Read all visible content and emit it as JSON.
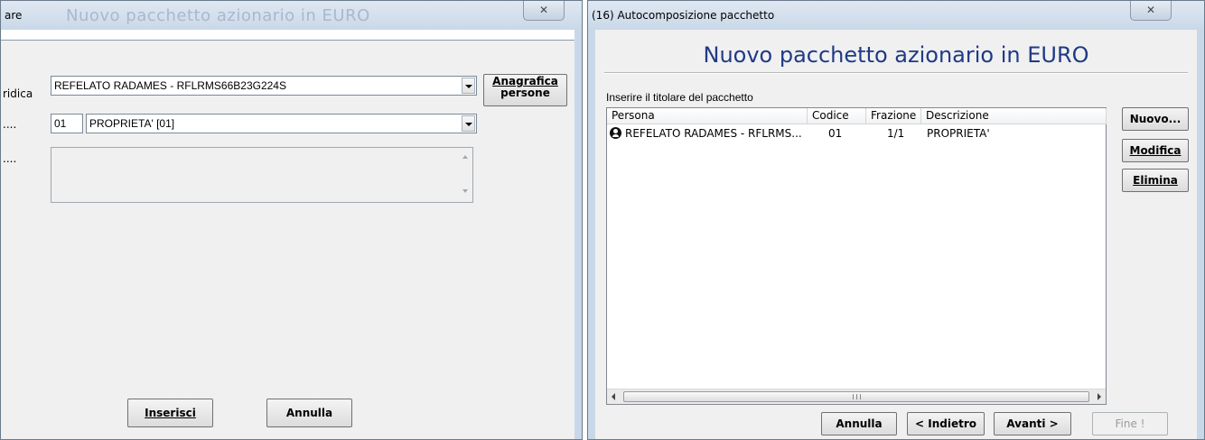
{
  "left_dialog": {
    "title_fragment": "are",
    "ghost_title": "Nuovo pacchetto azionario in EURO",
    "close_glyph": "✕",
    "label_persona": "ridica",
    "label_tipo": "....",
    "label_note": "....",
    "persona_value": "REFELATO RADAMES - RFLRMS66B23G224S",
    "tipo_code": "01",
    "tipo_value": "PROPRIETA' [01]",
    "note_value": "",
    "anagrafica_line1": "Anagrafica",
    "anagrafica_line2": "persone",
    "inserisci_label": "Inserisci",
    "annulla_label": "Annulla"
  },
  "right_dialog": {
    "title": "(16) Autocomposizione pacchetto",
    "close_glyph": "✕",
    "banner": "Nuovo pacchetto azionario in EURO",
    "prompt": "Inserire il titolare del pacchetto",
    "columns": [
      "Persona",
      "Codice",
      "Frazione",
      "Descrizione"
    ],
    "rows": [
      {
        "persona": "REFELATO RADAMES - RFLRMS...",
        "codice": "01",
        "frazione": "1/1",
        "descrizione": "PROPRIETA'"
      }
    ],
    "scroll_grip": "III",
    "side_buttons": {
      "nuovo": "Nuovo...",
      "modifica": "Modifica",
      "elimina": "Elimina"
    },
    "footer_buttons": {
      "annulla": "Annulla",
      "indietro": "< Indietro",
      "avanti": "Avanti >",
      "fine": "Fine !"
    }
  }
}
